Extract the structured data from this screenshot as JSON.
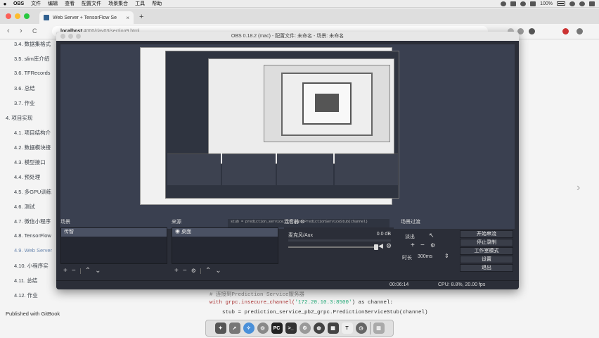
{
  "menubar": {
    "apple": "",
    "items": [
      "OBS",
      "文件",
      "编辑",
      "查看",
      "配置文件",
      "场景集合",
      "工具",
      "帮助"
    ],
    "battery": "100%",
    "icons": [
      "screen-record-icon",
      "bluetooth-icon",
      "wifi-icon",
      "volume-icon",
      "battery-icon",
      "search-icon",
      "siri-icon",
      "notification-icon"
    ]
  },
  "browser": {
    "tab_title": "Web Server + TensorFlow Se",
    "tab_close": "×",
    "new_tab": "+",
    "url_host": "localhost",
    "url_path": ":4000/day03/section9.html",
    "back": "‹",
    "forward": "›",
    "reload": "C"
  },
  "toc": {
    "items": [
      {
        "label": "3.4. 数据集格式"
      },
      {
        "label": "3.5. slim库介绍"
      },
      {
        "label": "3.6. TFRecords"
      },
      {
        "label": "3.6. 总结"
      },
      {
        "label": "3.7. 作业"
      },
      {
        "label": "4. 项目实现"
      },
      {
        "label": "4.1. 项目结构介"
      },
      {
        "label": "4.2. 数据模块接"
      },
      {
        "label": "4.3. 模型接口"
      },
      {
        "label": "4.4. 预处理"
      },
      {
        "label": "4.5. 多GPU训练"
      },
      {
        "label": "4.6. 测试"
      },
      {
        "label": "4.7. 微信小程序"
      },
      {
        "label": "4.8. TensorFlow"
      },
      {
        "label": "4.9. Web Server"
      },
      {
        "label": "4.10. 小程序实"
      },
      {
        "label": "4.11. 总结"
      },
      {
        "label": "4.12. 作业"
      }
    ],
    "published": "Published with GitBook"
  },
  "code": {
    "line1_comment": "# 连接到Prediction Service服务器",
    "line2_pre": "with grpc.insecure_channel(",
    "line2_str": "'172.20.10.3:8500'",
    "line2_post": ") as channel:",
    "line3": "stub = prediction_service_pb2_grpc.PredictionServiceStub(channel)"
  },
  "obs": {
    "title": "OBS 0.18.2 (mac) - 配置文件: 未命名 - 场景: 未命名",
    "preview_code": "stub = prediction_service_pb2_grpc.PredictionServiceStub(channel)",
    "scenes_title": "场景",
    "scenes": [
      "传智"
    ],
    "sources_title": "来源",
    "sources": [
      "桌面"
    ],
    "mixer_title": "混音器",
    "mixer_channel": "麦克风/Aux",
    "mixer_db": "0.0 dB",
    "transition_title": "场景过渡",
    "fade_label": "淡出",
    "duration_label": "时长",
    "duration_value": "300ms",
    "buttons": [
      "开始串流",
      "停止录制",
      "工作室模式",
      "设置",
      "退出"
    ],
    "status_time": "00:06:14",
    "status_cpu": "CPU: 8.8%, 20.00 fps"
  },
  "dock": {
    "apps": [
      "launchpad-icon",
      "rocket-icon",
      "safari-icon",
      "chrome-icon",
      "pycharm-icon",
      "terminal-icon",
      "system-preferences-icon",
      "obs-icon",
      "typora-icon",
      "clock-icon",
      "trash-icon"
    ],
    "pycharm_text": "PC",
    "typora_text": "T"
  },
  "colors": {
    "obs_bg": "#2b2e38",
    "preview_bg": "#3a4050",
    "active_toc": "#6e8ab0"
  }
}
